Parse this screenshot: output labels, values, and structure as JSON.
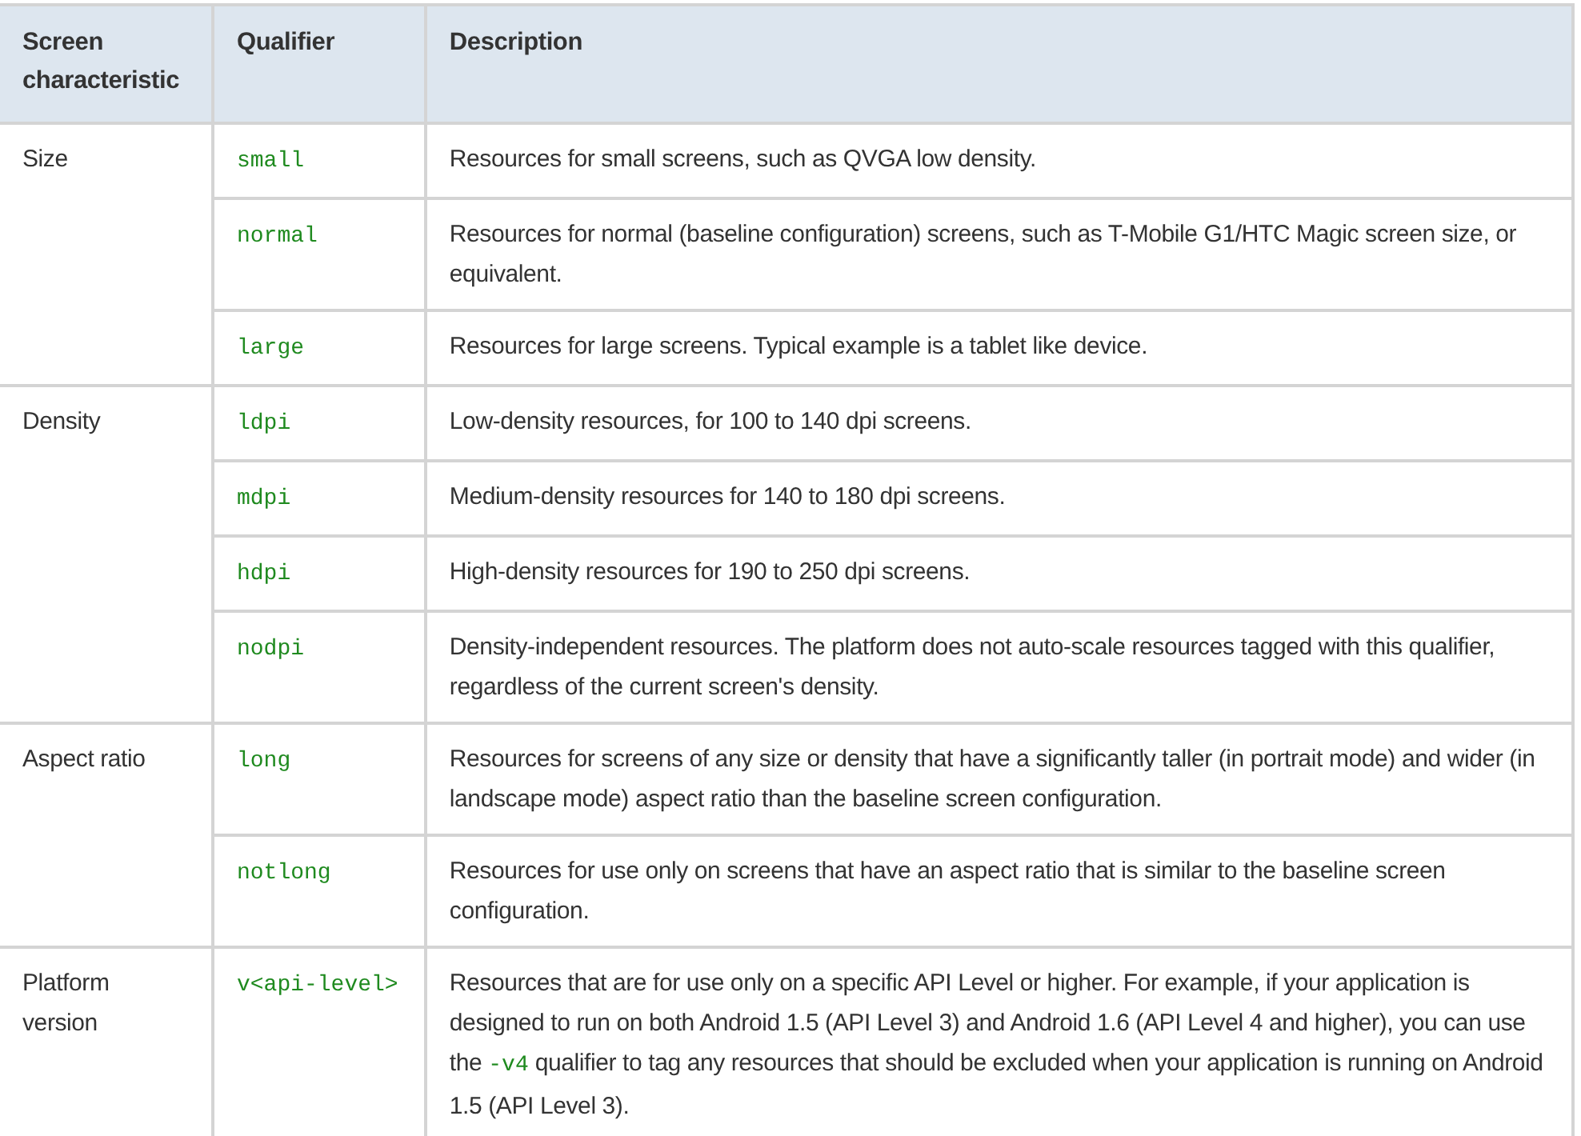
{
  "table": {
    "columns": [
      "Screen characteristic",
      "Qualifier",
      "Description"
    ],
    "groups": [
      {
        "characteristic": "Size",
        "rows": [
          {
            "qualifier": "small",
            "description": [
              {
                "kind": "plain",
                "text": "Resources for small screens, such as QVGA low density."
              }
            ]
          },
          {
            "qualifier": "normal",
            "description": [
              {
                "kind": "plain",
                "text": "Resources for normal (baseline configuration) screens, such as T-Mobile G1/HTC Magic screen size, or equivalent."
              }
            ]
          },
          {
            "qualifier": "large",
            "description": [
              {
                "kind": "plain",
                "text": "Resources for large screens. Typical example is a tablet like device."
              }
            ]
          }
        ]
      },
      {
        "characteristic": "Density",
        "rows": [
          {
            "qualifier": "ldpi",
            "description": [
              {
                "kind": "plain",
                "text": "Low-density resources, for 100 to 140 dpi screens."
              }
            ]
          },
          {
            "qualifier": "mdpi",
            "description": [
              {
                "kind": "plain",
                "text": "Medium-density resources for 140 to 180 dpi screens."
              }
            ]
          },
          {
            "qualifier": "hdpi",
            "description": [
              {
                "kind": "plain",
                "text": "High-density resources for 190 to 250 dpi screens."
              }
            ]
          },
          {
            "qualifier": "nodpi",
            "description": [
              {
                "kind": "plain",
                "text": "Density-independent resources. The platform does not auto-scale resources tagged with this qualifier, regardless of the current screen's density."
              }
            ]
          }
        ]
      },
      {
        "characteristic": "Aspect ratio",
        "rows": [
          {
            "qualifier": "long",
            "description": [
              {
                "kind": "plain",
                "text": "Resources for screens of any size or density that have a significantly taller (in portrait mode) and wider (in landscape mode) aspect ratio than the baseline screen configuration."
              }
            ]
          },
          {
            "qualifier": "notlong",
            "description": [
              {
                "kind": "plain",
                "text": "Resources for use only on screens that have an aspect ratio that is similar to the baseline screen configuration."
              }
            ]
          }
        ]
      },
      {
        "characteristic": "Platform version",
        "rows": [
          {
            "qualifier": "v<api-level>",
            "description": [
              {
                "kind": "plain",
                "text": "Resources that are for use only on a specific API Level or higher. For example, if your application is designed to run on both Android 1.5 (API Level 3) and Android 1.6 (API Level 4 and higher), you can use the "
              },
              {
                "kind": "code",
                "text": "-v4"
              },
              {
                "kind": "plain",
                "text": " qualifier to tag any resources that should be excluded when your application is running on Android 1.5 (API Level 3)."
              }
            ]
          }
        ]
      }
    ]
  }
}
